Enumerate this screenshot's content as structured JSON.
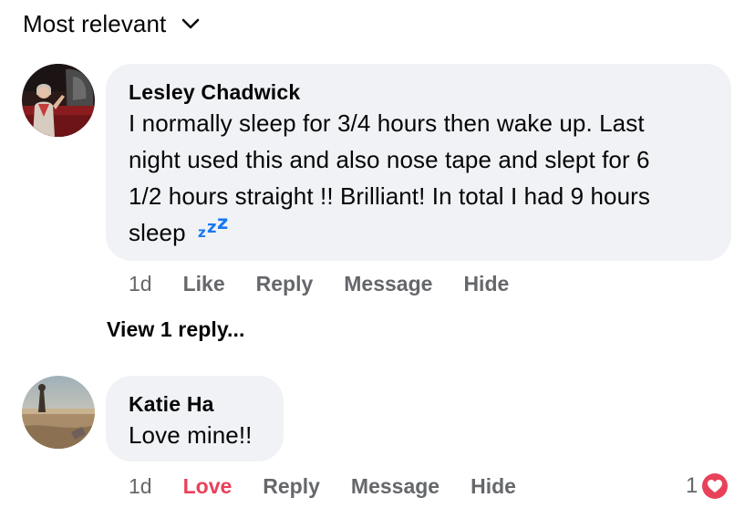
{
  "sort": {
    "label": "Most relevant"
  },
  "comments": [
    {
      "author": "Lesley Chadwick",
      "text": "I normally sleep for 3/4 hours then wake up. Last night used this and also nose tape and slept for 6 1/2 hours straight !! Brilliant! In total I had 9 hours sleep",
      "text_lines": [
        "I normally sleep for 3/4 hours then wake up. Last",
        "night used this and also nose tape and slept for 6",
        "1/2 hours straight !! Brilliant! In total I had 9 hours",
        "sleep"
      ],
      "emoji": "zzz-sleep-icon",
      "time": "1d",
      "actions": {
        "like": "Like",
        "reply": "Reply",
        "message": "Message",
        "hide": "Hide"
      }
    },
    {
      "author": "Katie Ha",
      "text": "Love mine!!",
      "time": "1d",
      "actions": {
        "love": "Love",
        "reply": "Reply",
        "message": "Message",
        "hide": "Hide"
      },
      "reaction_count": "1",
      "reaction_icon": "heart-icon"
    }
  ],
  "view_replies": "View 1 reply...",
  "colors": {
    "bubble": "#f0f2f5",
    "meta": "#65676b",
    "love": "#e8415a",
    "zzz": "#1877f2"
  }
}
